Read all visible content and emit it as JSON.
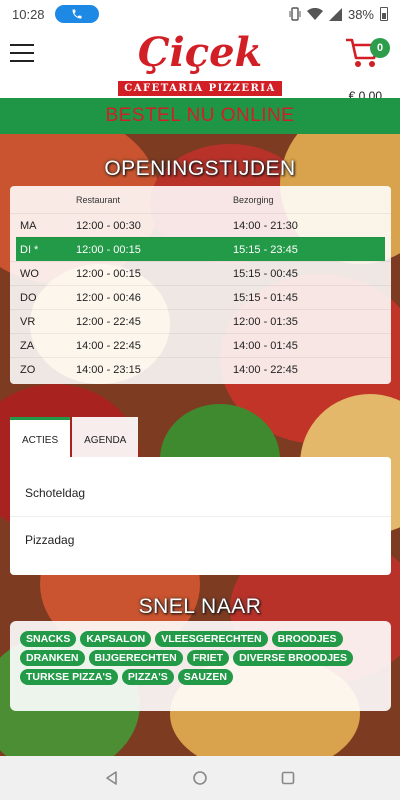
{
  "status": {
    "time": "10:28",
    "battery": "38%"
  },
  "header": {
    "brand_name": "Çiçek",
    "brand_sub": "CAFETARIA PIZZERIA",
    "cart_count": "0",
    "cart_total": "€ 0.00"
  },
  "order_bar": "BESTEL NU ONLINE",
  "hours": {
    "title": "OPENINGSTIJDEN",
    "col_restaurant": "Restaurant",
    "col_bezorging": "Bezorging",
    "rows": [
      {
        "day": "MA",
        "restaurant": "12:00 - 00:30",
        "bezorging": "14:00 - 21:30"
      },
      {
        "day": "DI *",
        "restaurant": "12:00 - 00:15",
        "bezorging": "15:15 - 23:45"
      },
      {
        "day": "WO",
        "restaurant": "12:00 - 00:15",
        "bezorging": "15:15 - 00:45"
      },
      {
        "day": "DO",
        "restaurant": "12:00 - 00:46",
        "bezorging": "15:15 - 01:45"
      },
      {
        "day": "VR",
        "restaurant": "12:00 - 22:45",
        "bezorging": "12:00 - 01:35"
      },
      {
        "day": "ZA",
        "restaurant": "14:00 - 22:45",
        "bezorging": "14:00 - 01:45"
      },
      {
        "day": "ZO",
        "restaurant": "14:00 - 23:15",
        "bezorging": "14:00 - 22:45"
      }
    ]
  },
  "tabs": {
    "items": [
      "ACTIES",
      "AGENDA"
    ],
    "panel_items": [
      "Schoteldag",
      "Pizzadag"
    ]
  },
  "quick": {
    "title": "SNEL NAAR",
    "links": [
      "SNACKS",
      "KAPSALON",
      "VLEESGERECHTEN",
      "BROODJES",
      "DRANKEN",
      "BIJGERECHTEN",
      "FRIET",
      "DIVERSE BROODJES",
      "TURKSE PIZZA'S",
      "PIZZA'S",
      "SAUZEN"
    ]
  },
  "colors": {
    "brand_red": "#d21f26",
    "brand_green": "#239a48"
  }
}
